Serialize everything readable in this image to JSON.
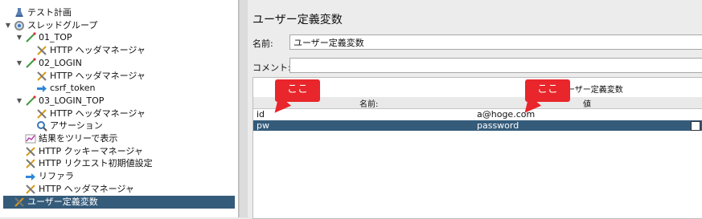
{
  "tree": {
    "items": [
      {
        "label": "テスト計画",
        "twisty": "",
        "icon": "flask-icon",
        "depth": 0
      },
      {
        "label": "スレッドグループ",
        "twisty": "▼",
        "icon": "gear-icon",
        "depth": 0
      },
      {
        "label": "01_TOP",
        "twisty": "▼",
        "icon": "pipette-icon",
        "depth": 1
      },
      {
        "label": "HTTP ヘッダマネージャ",
        "twisty": "",
        "icon": "tools-icon",
        "depth": 2
      },
      {
        "label": "02_LOGIN",
        "twisty": "▼",
        "icon": "pipette-icon",
        "depth": 1
      },
      {
        "label": "HTTP ヘッダマネージャ",
        "twisty": "",
        "icon": "tools-icon",
        "depth": 2
      },
      {
        "label": "csrf_token",
        "twisty": "",
        "icon": "arrow-icon",
        "depth": 2
      },
      {
        "label": "03_LOGIN_TOP",
        "twisty": "▼",
        "icon": "pipette-icon",
        "depth": 1
      },
      {
        "label": "HTTP ヘッダマネージャ",
        "twisty": "",
        "icon": "tools-icon",
        "depth": 2
      },
      {
        "label": "アサーション",
        "twisty": "",
        "icon": "magnifier-icon",
        "depth": 2
      },
      {
        "label": "結果をツリーで表示",
        "twisty": "",
        "icon": "chart-icon",
        "depth": 1
      },
      {
        "label": "HTTP クッキーマネージャ",
        "twisty": "",
        "icon": "tools-icon",
        "depth": 1
      },
      {
        "label": "HTTP リクエスト初期値設定",
        "twisty": "",
        "icon": "tools-icon",
        "depth": 1
      },
      {
        "label": "リファラ",
        "twisty": "",
        "icon": "arrow-icon",
        "depth": 1
      },
      {
        "label": "HTTP ヘッダマネージャ",
        "twisty": "",
        "icon": "tools-icon",
        "depth": 1
      },
      {
        "label": "ユーザー定義変数",
        "twisty": "",
        "icon": "tools-icon",
        "depth": 1,
        "selected": true
      }
    ]
  },
  "panel": {
    "title": "ユーザー定義変数",
    "name_label": "名前:",
    "name_value": "ユーザー定義変数",
    "comment_label": "コメント:",
    "comment_value": "",
    "table_caption": "ユーザー定義変数",
    "col_name": "名前:",
    "col_value": "値",
    "rows": [
      {
        "name": "id",
        "value": "a@hoge.com"
      },
      {
        "name": "pw",
        "value": "password",
        "selected": true
      }
    ]
  },
  "callouts": [
    {
      "text": "ここ"
    },
    {
      "text": "ここ"
    }
  ],
  "colors": {
    "selection": "#355b7a",
    "callout": "#e8262b"
  }
}
